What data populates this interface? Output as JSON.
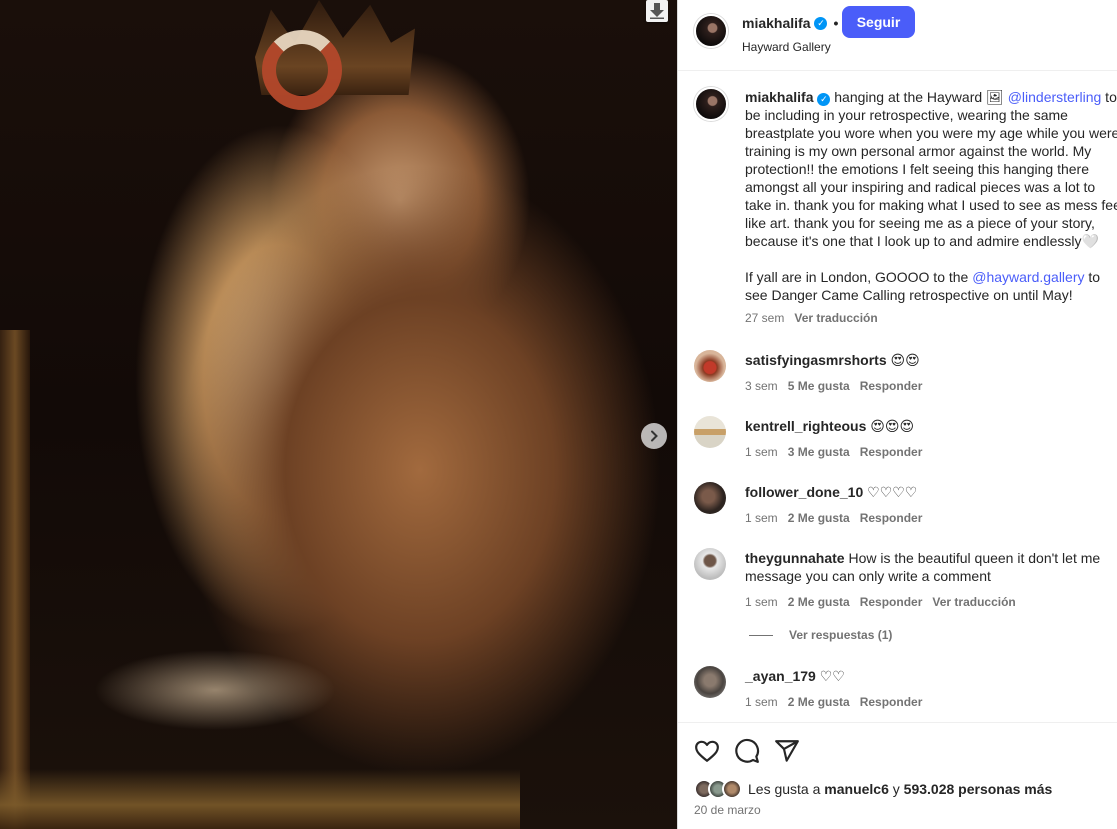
{
  "post": {
    "username": "miakhalifa",
    "location": "Hayward Gallery",
    "follow_label": "Seguir",
    "separator": "•"
  },
  "caption": {
    "username": "miakhalifa",
    "text_1a": "hanging at the Hayward 🖼 ",
    "mention_1": "@lindersterling",
    "text_1b": " to be including in your retrospective, wearing the same breastplate you wore when you were my age while you were training is my own personal armor against the world. My protection!! the emotions I felt seeing this hanging there amongst all your inspiring and radical pieces was a lot to take in. thank you for making what I used to see as mess feel like art. thank you for seeing me as a piece of your story, because it's one that I look up to and admire endlessly🤍",
    "text_2a": "If yall are in London, GOOOO to the ",
    "mention_2": "@hayward.gallery",
    "text_2b": " to see Danger Came Calling retrospective on until May!",
    "time": "27 sem",
    "translate": "Ver traducción"
  },
  "comments": [
    {
      "user": "satisfyingasmrshorts",
      "text": "😍😍",
      "time": "3 sem",
      "likes": "5 Me gusta",
      "reply": "Responder"
    },
    {
      "user": "kentrell_righteous",
      "text": "😍😍😍",
      "time": "1 sem",
      "likes": "3 Me gusta",
      "reply": "Responder"
    },
    {
      "user": "follower_done_10",
      "text": "♡♡♡♡",
      "time": "1 sem",
      "likes": "2 Me gusta",
      "reply": "Responder"
    },
    {
      "user": "theygunnahate",
      "text": "How is the beautiful queen it don't let me message you can only write a comment",
      "time": "1 sem",
      "likes": "2 Me gusta",
      "reply": "Responder",
      "translate": "Ver traducción"
    },
    {
      "user": "_ayan_179",
      "text": "♡♡",
      "time": "1 sem",
      "likes": "2 Me gusta",
      "reply": "Responder"
    }
  ],
  "view_replies": "Ver respuestas (1)",
  "likes_summary": {
    "prefix": "Les gusta a ",
    "user": "manuelc6",
    "middle": " y ",
    "count": "593.028 personas más"
  },
  "date": "20 de marzo",
  "icons": {
    "like": "heart-icon",
    "comment": "comment-icon",
    "share": "share-icon",
    "download": "download-icon",
    "next": "chevron-right-icon"
  },
  "colors": {
    "accent": "#4a5df9",
    "verified": "#0095f6",
    "muted": "#737373"
  }
}
